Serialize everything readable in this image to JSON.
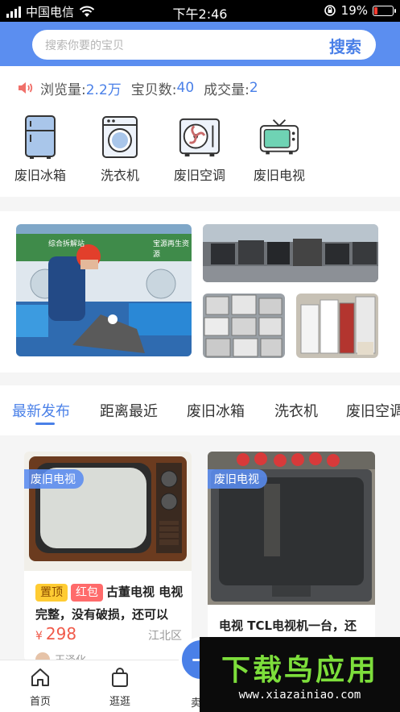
{
  "status_bar": {
    "carrier": "中国电信",
    "time": "下午2:46",
    "battery": "19%",
    "battery_level": 0.19,
    "icons": [
      "signal-icon",
      "wifi-icon",
      "orientation-lock-icon",
      "battery-icon"
    ]
  },
  "header": {
    "search_placeholder": "搜索你要的宝贝",
    "search_button": "搜索",
    "accent_color": "#5b8ef0"
  },
  "stats": {
    "views_label": "浏览量:",
    "views_value": "2.2万",
    "items_label": "宝贝数:",
    "items_value": "40",
    "deals_label": "成交量:",
    "deals_value": "2"
  },
  "categories": [
    {
      "label": "废旧冰箱",
      "icon": "fridge-icon"
    },
    {
      "label": "洗衣机",
      "icon": "washing-machine-icon"
    },
    {
      "label": "废旧空调",
      "icon": "air-conditioner-icon"
    },
    {
      "label": "废旧电视",
      "icon": "tv-icon"
    }
  ],
  "banner": {
    "sign_texts": [
      "综合拆解站",
      "宝源再生资源",
      "综合拆解站",
      "宝源再生资源"
    ]
  },
  "tabs": [
    {
      "label": "最新发布",
      "active": true
    },
    {
      "label": "距离最近",
      "active": false
    },
    {
      "label": "废旧冰箱",
      "active": false
    },
    {
      "label": "洗衣机",
      "active": false
    },
    {
      "label": "废旧空调",
      "active": false
    }
  ],
  "listings": [
    {
      "category": "废旧电视",
      "tags": [
        "置顶",
        "红包"
      ],
      "title": "古董电视 电视完整，没有破损，还可以",
      "price": "298",
      "currency": "¥",
      "district": "江北区",
      "seller": "王泽化"
    },
    {
      "category": "废旧电视",
      "title": "电视 TCL电视机一台，还"
    }
  ],
  "bottom_nav": [
    {
      "label": "首页",
      "icon": "home-icon"
    },
    {
      "label": "逛逛",
      "icon": "shopping-bag-icon"
    },
    {
      "label": "卖废",
      "icon": "plus-icon"
    }
  ],
  "watermark": {
    "title": "下载鸟应用",
    "url": "www.xiazainiao.com"
  }
}
